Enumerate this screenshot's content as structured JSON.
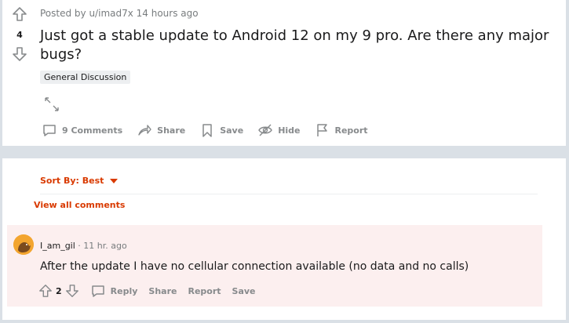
{
  "post": {
    "vote_count": "4",
    "meta": "Posted by u/imad7x 14 hours ago",
    "title": "Just got a stable update to Android 12 on my 9 pro. Are there any major bugs?",
    "flair": "General Discussion",
    "actions": {
      "comments": "9 Comments",
      "share": "Share",
      "save": "Save",
      "hide": "Hide",
      "report": "Report"
    }
  },
  "comments_section": {
    "sort_label": "Sort By: Best",
    "view_all": "View all comments",
    "comment": {
      "author": "I_am_gil",
      "separator": "·",
      "time": "11 hr. ago",
      "body": "After the update I have no cellular connection available (no data and no calls)",
      "vote_count": "2",
      "reply": "Reply",
      "share": "Share",
      "report": "Report",
      "save": "Save"
    }
  },
  "colors": {
    "accent": "#d93a00",
    "background": "#dae0e6",
    "comment_highlight": "#fcefef"
  }
}
